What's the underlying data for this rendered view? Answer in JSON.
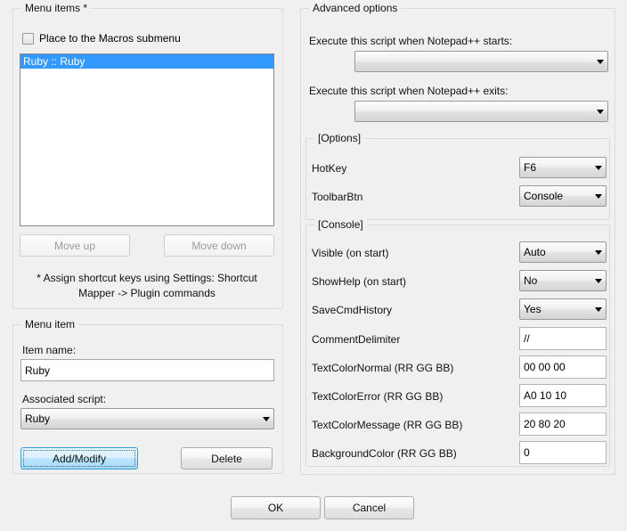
{
  "menu_items_group": {
    "title": "Menu items *",
    "checkbox": {
      "label": "Place to the Macros submenu",
      "checked": false
    },
    "list": {
      "items": [
        "Ruby :: Ruby"
      ],
      "selected_index": 0
    },
    "move_up_label": "Move up",
    "move_down_label": "Move down",
    "hint_line1": "* Assign shortcut keys using Settings:  Shortcut",
    "hint_line2": "Mapper -> Plugin commands"
  },
  "menu_item_group": {
    "title": "Menu item",
    "item_name_label": "Item name:",
    "item_name_value": "Ruby",
    "associated_script_label": "Associated script:",
    "associated_script_value": "Ruby",
    "add_modify_label": "Add/Modify",
    "delete_label": "Delete"
  },
  "advanced_group": {
    "title": "Advanced options",
    "on_start_label": "Execute this script when Notepad++ starts:",
    "on_start_value": "",
    "on_exit_label": "Execute this script when Notepad++ exits:",
    "on_exit_value": ""
  },
  "options_group": {
    "title": "[Options]",
    "rows": [
      {
        "label": "HotKey",
        "value": "F6",
        "kind": "combo"
      },
      {
        "label": "ToolbarBtn",
        "value": "Console",
        "kind": "combo"
      }
    ]
  },
  "console_group": {
    "title": "[Console]",
    "rows": [
      {
        "label": "Visible (on start)",
        "value": "Auto",
        "kind": "combo"
      },
      {
        "label": "ShowHelp (on start)",
        "value": "No",
        "kind": "combo"
      },
      {
        "label": "SaveCmdHistory",
        "value": "Yes",
        "kind": "combo"
      },
      {
        "label": "CommentDelimiter",
        "value": "//",
        "kind": "text"
      },
      {
        "label": "TextColorNormal (RR GG BB)",
        "value": "00 00 00",
        "kind": "text"
      },
      {
        "label": "TextColorError (RR GG BB)",
        "value": "A0 10 10",
        "kind": "text"
      },
      {
        "label": "TextColorMessage (RR GG BB)",
        "value": "20 80 20",
        "kind": "text"
      },
      {
        "label": "BackgroundColor (RR GG BB)",
        "value": "0",
        "kind": "text"
      }
    ]
  },
  "footer": {
    "ok_label": "OK",
    "cancel_label": "Cancel"
  },
  "colors": {
    "dialog_background": "#f0f0f0",
    "selection_blue": "#3399ff",
    "default_button_border": "#2f9fd0",
    "disabled_text": "#9a9a9a"
  }
}
